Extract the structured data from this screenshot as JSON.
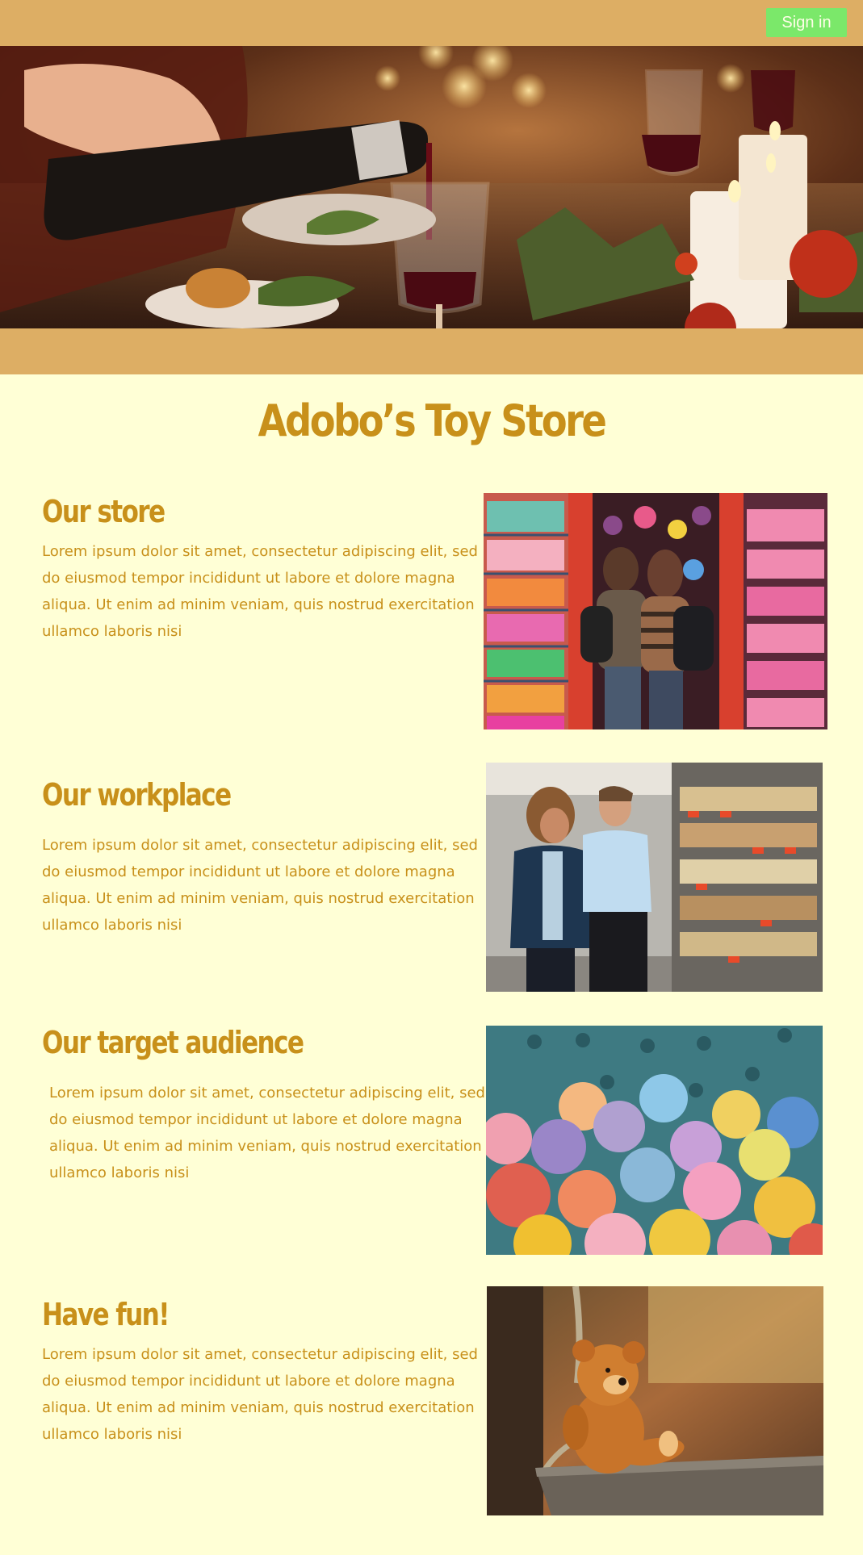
{
  "header": {
    "signin_label": "Sign in"
  },
  "page": {
    "title": "Adobo’s Toy Store"
  },
  "sections": [
    {
      "title": "Our store",
      "text": "Lorem ipsum dolor sit amet, consectetur adipiscing elit, sed do eiusmod tempor incididunt ut labore et dolore magna aliqua. Ut enim ad minim veniam, quis nostrud exercitation ullamco laboris nisi"
    },
    {
      "title": "Our workplace",
      "text": "Lorem ipsum dolor sit amet, consectetur adipiscing elit, sed do eiusmod tempor incididunt ut labore et dolore magna aliqua. Ut enim ad minim veniam, quis nostrud exercitation ullamco laboris nisi"
    },
    {
      "title": "Our target audience",
      "text": "Lorem ipsum dolor sit amet, consectetur adipiscing elit, sed do eiusmod tempor incididunt ut labore et dolore magna aliqua. Ut enim ad minim veniam, quis nostrud exercitation ullamco laboris nisi"
    },
    {
      "title": "Have fun!",
      "text": "Lorem ipsum dolor sit amet, consectetur adipiscing elit, sed do eiusmod tempor incididunt ut labore et dolore magna aliqua. Ut enim ad minim veniam, quis nostrud exercitation ullamco laboris nisi"
    }
  ],
  "colors": {
    "header_bg": "#ddae64",
    "page_bg": "#ffffd6",
    "accent_text": "#c8901a",
    "signin_bg": "#7be86a"
  }
}
